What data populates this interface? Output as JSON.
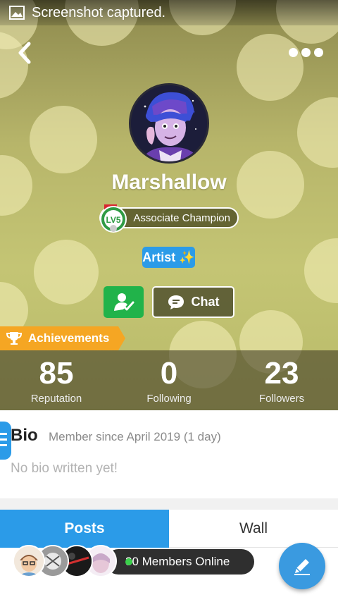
{
  "status_bar": {
    "notification": "Screenshot captured."
  },
  "profile": {
    "username": "Marshallow",
    "level_badge": "LV5",
    "title": "Associate Champion",
    "tag": "Artist ✨",
    "chat_label": "Chat",
    "achievements_label": "Achievements"
  },
  "stats": [
    {
      "value": "85",
      "label": "Reputation"
    },
    {
      "value": "0",
      "label": "Following"
    },
    {
      "value": "23",
      "label": "Followers"
    }
  ],
  "bio": {
    "heading": "Bio",
    "member_since": "Member since April 2019 (1 day)",
    "text": "No bio written yet!"
  },
  "tabs": {
    "posts": "Posts",
    "wall": "Wall"
  },
  "online": {
    "label": "30 Members Online"
  },
  "icons": {
    "back": "chevron-left-icon",
    "more": "more-dots-icon",
    "follow": "follow-user-icon",
    "chat": "chat-bubble-icon",
    "trophy": "trophy-icon",
    "compose": "pencil-icon"
  },
  "colors": {
    "accent": "#2b9be8",
    "follow": "#21b34a",
    "achievements": "#f5a623",
    "online": "#3bd14b"
  }
}
